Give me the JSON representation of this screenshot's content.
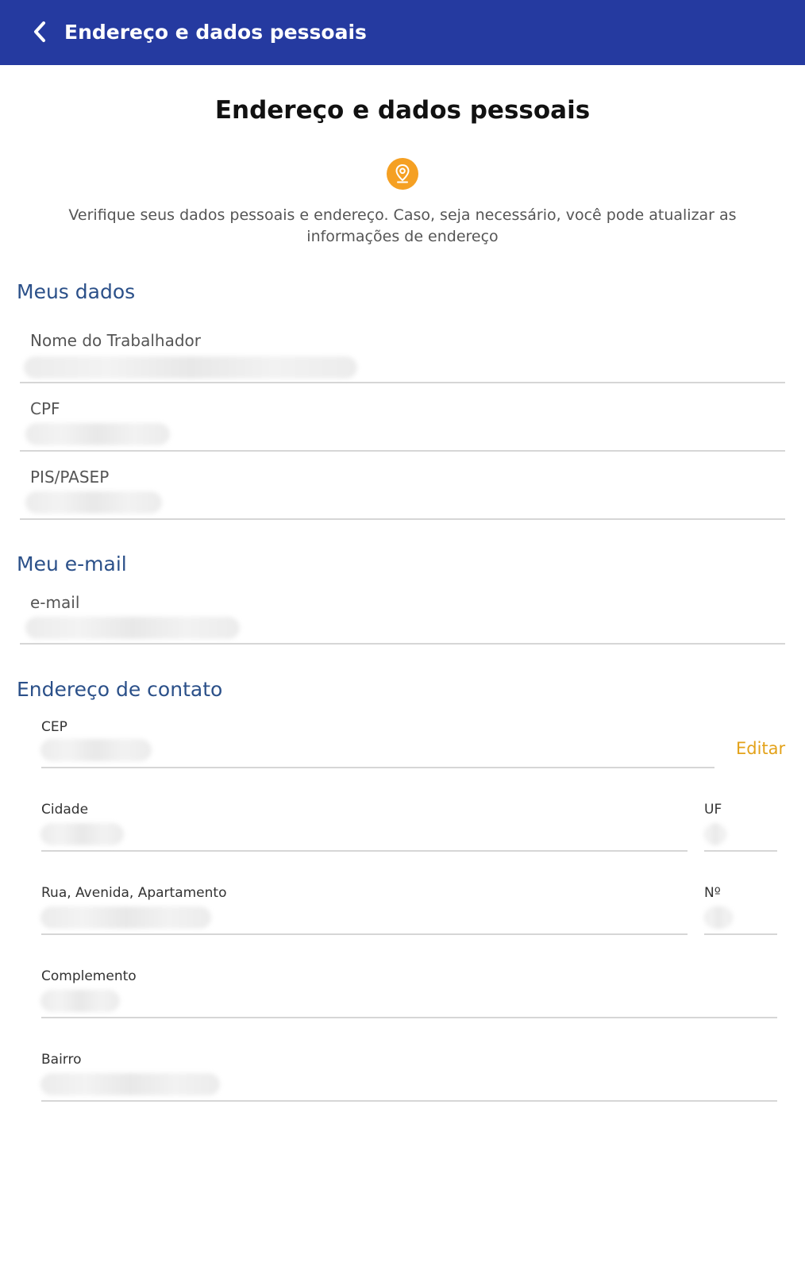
{
  "appbar": {
    "title": "Endereço e dados pessoais",
    "back_icon": "chevron-left-icon",
    "background": "#253aa0"
  },
  "main": {
    "title": "Endereço e dados pessoais",
    "icon": "location-pin-icon",
    "icon_color": "#f5a023",
    "description": "Verifique seus dados pessoais e endereço. Caso, seja necessário, você pode atualizar as informações de endereço"
  },
  "meus_dados": {
    "title": "Meus dados",
    "fields": [
      {
        "label": "Nome do Trabalhador",
        "value": ""
      },
      {
        "label": "CPF",
        "value": ""
      },
      {
        "label": "PIS/PASEP",
        "value": ""
      }
    ]
  },
  "meu_email": {
    "title": "Meu e-mail",
    "fields": [
      {
        "label": "e-mail",
        "value": ""
      }
    ]
  },
  "endereco": {
    "title": "Endereço de contato",
    "edit_label": "Editar",
    "fields": {
      "cep": {
        "label": "CEP",
        "value": ""
      },
      "cidade": {
        "label": "Cidade",
        "value": ""
      },
      "uf": {
        "label": "UF",
        "value": ""
      },
      "rua": {
        "label": "Rua, Avenida, Apartamento",
        "value": ""
      },
      "numero": {
        "label": "Nº",
        "value": ""
      },
      "complemento": {
        "label": "Complemento",
        "value": ""
      },
      "bairro": {
        "label": "Bairro",
        "value": ""
      }
    }
  },
  "colors": {
    "section_title": "#2b5089",
    "edit_link": "#e3a21a",
    "divider": "#d6d6d6"
  }
}
